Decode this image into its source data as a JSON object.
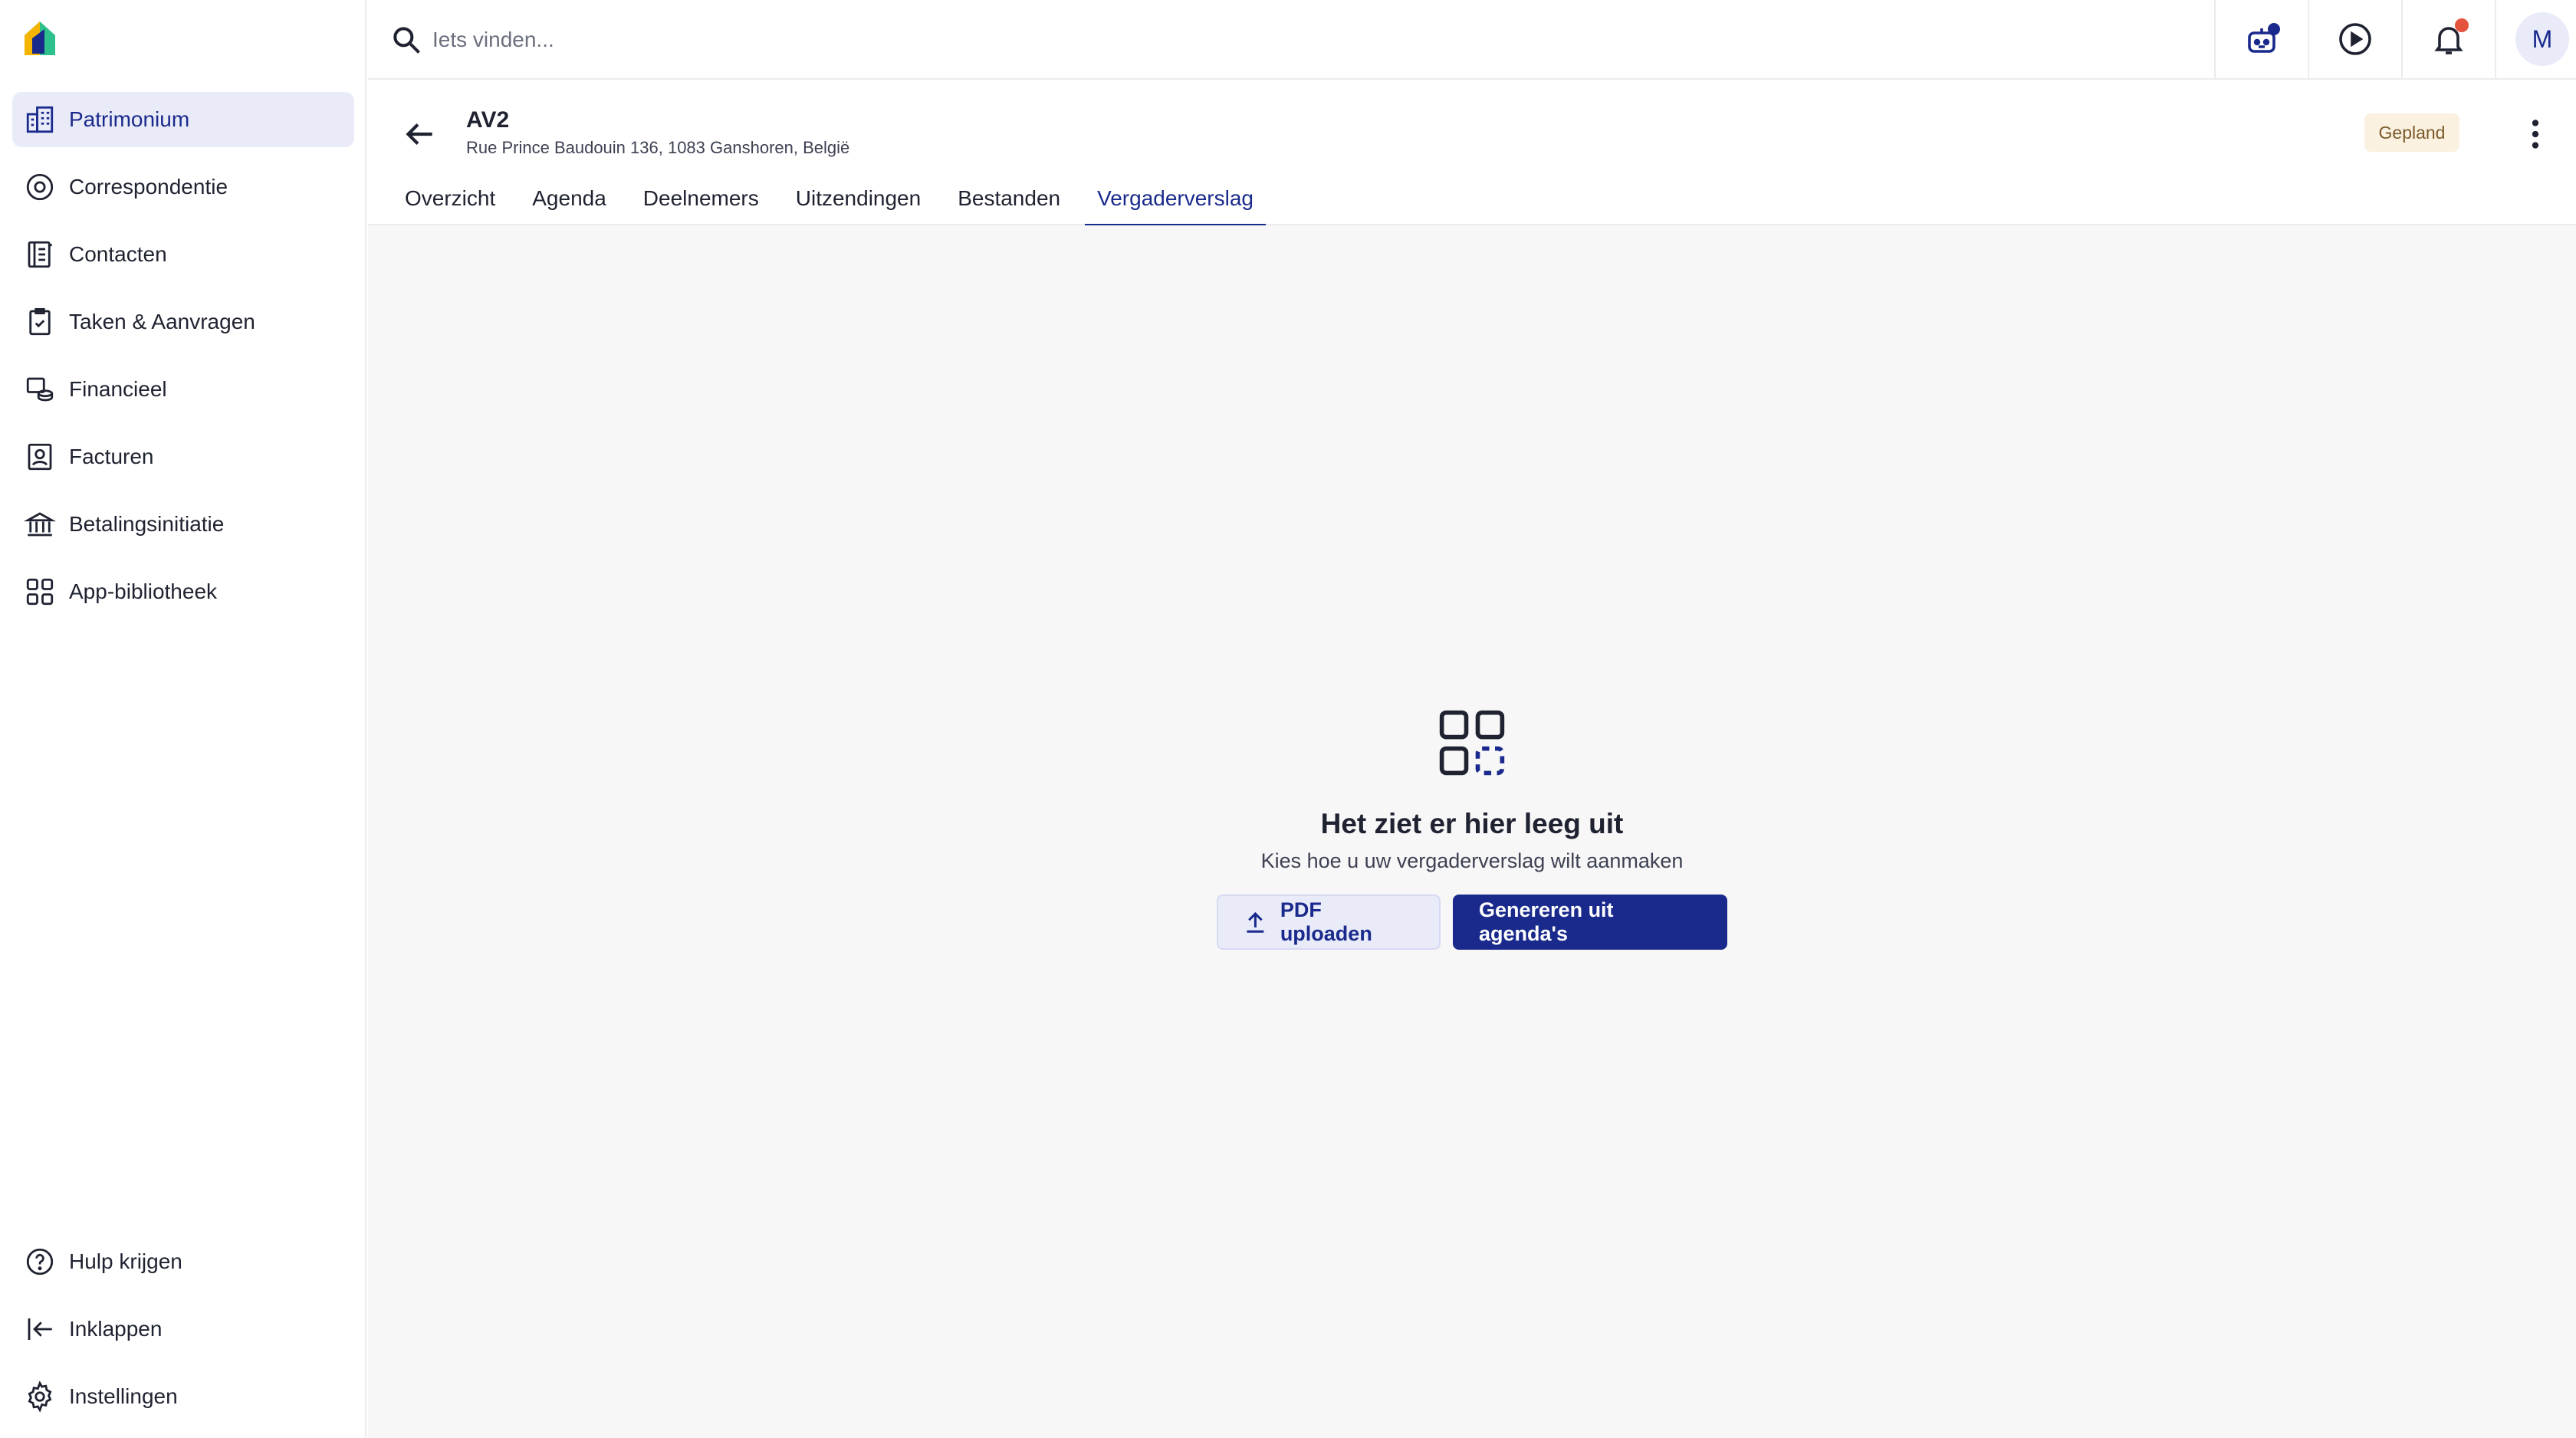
{
  "app": {
    "logo_icon": "house-logo-icon"
  },
  "sidebar": {
    "items": [
      {
        "label": "Patrimonium",
        "icon": "building-icon",
        "active": true
      },
      {
        "label": "Correspondentie",
        "icon": "mail-at-icon"
      },
      {
        "label": "Contacten",
        "icon": "contacts-book-icon"
      },
      {
        "label": "Taken & Aanvragen",
        "icon": "clipboard-check-icon"
      },
      {
        "label": "Financieel",
        "icon": "coins-icon"
      },
      {
        "label": "Facturen",
        "icon": "invoice-icon"
      },
      {
        "label": "Betalingsinitiatie",
        "icon": "bank-icon"
      },
      {
        "label": "App-bibliotheek",
        "icon": "apps-grid-icon"
      }
    ],
    "bottom_items": [
      {
        "label": "Hulp krijgen",
        "icon": "help-circle-icon"
      },
      {
        "label": "Inklappen",
        "icon": "collapse-left-icon"
      },
      {
        "label": "Instellingen",
        "icon": "gear-icon"
      }
    ]
  },
  "topbar": {
    "search_placeholder": "Iets vinden...",
    "avatar_initial": "M"
  },
  "header": {
    "title": "AV2",
    "subtitle": "Rue Prince Baudouin 136, 1083 Ganshoren, België",
    "status_badge": "Gepland",
    "tabs": [
      {
        "label": "Overzicht"
      },
      {
        "label": "Agenda"
      },
      {
        "label": "Deelnemers"
      },
      {
        "label": "Uitzendingen"
      },
      {
        "label": "Bestanden"
      },
      {
        "label": "Vergaderverslag",
        "active": true
      }
    ]
  },
  "empty_state": {
    "title": "Het ziet er hier leeg uit",
    "subtitle": "Kies hoe u uw vergaderverslag wilt aanmaken",
    "upload_button": "PDF uploaden",
    "generate_button": "Genereren uit agenda's"
  },
  "colors": {
    "accent": "#1a2a8c",
    "accent_light": "#e9ebf9",
    "badge_bg": "#faf1e1",
    "notification": "#e5533d"
  }
}
